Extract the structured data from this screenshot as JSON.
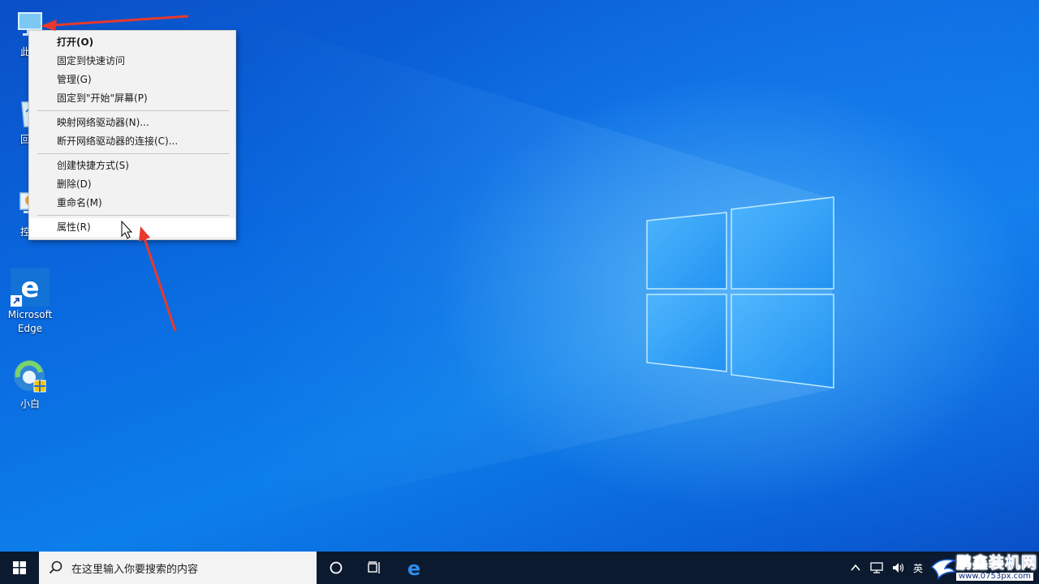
{
  "desktop": {
    "icons": [
      {
        "label": "此电"
      },
      {
        "label": "回收"
      },
      {
        "label": "控制"
      },
      {
        "label": "Microsoft Edge",
        "line1": "Microsoft",
        "line2": "Edge"
      },
      {
        "label": "小白"
      }
    ]
  },
  "context_menu": {
    "items": [
      {
        "label": "打开(O)"
      },
      {
        "label": "固定到快速访问"
      },
      {
        "label": "管理(G)"
      },
      {
        "label": "固定到\"开始\"屏幕(P)"
      },
      {
        "label": "映射网络驱动器(N)..."
      },
      {
        "label": "断开网络驱动器的连接(C)..."
      },
      {
        "label": "创建快捷方式(S)"
      },
      {
        "label": "删除(D)"
      },
      {
        "label": "重命名(M)"
      },
      {
        "label": "属性(R)"
      }
    ]
  },
  "taskbar": {
    "search_placeholder": "在这里输入你要搜索的内容",
    "tray_ime": "英",
    "watermark_main": "鹏鑫装机网",
    "watermark_url": "www.0753px.com"
  },
  "colors": {
    "accent": "#0a6ae0",
    "annotation_arrow": "#e8392b",
    "taskbar": "#0b1a2e"
  }
}
